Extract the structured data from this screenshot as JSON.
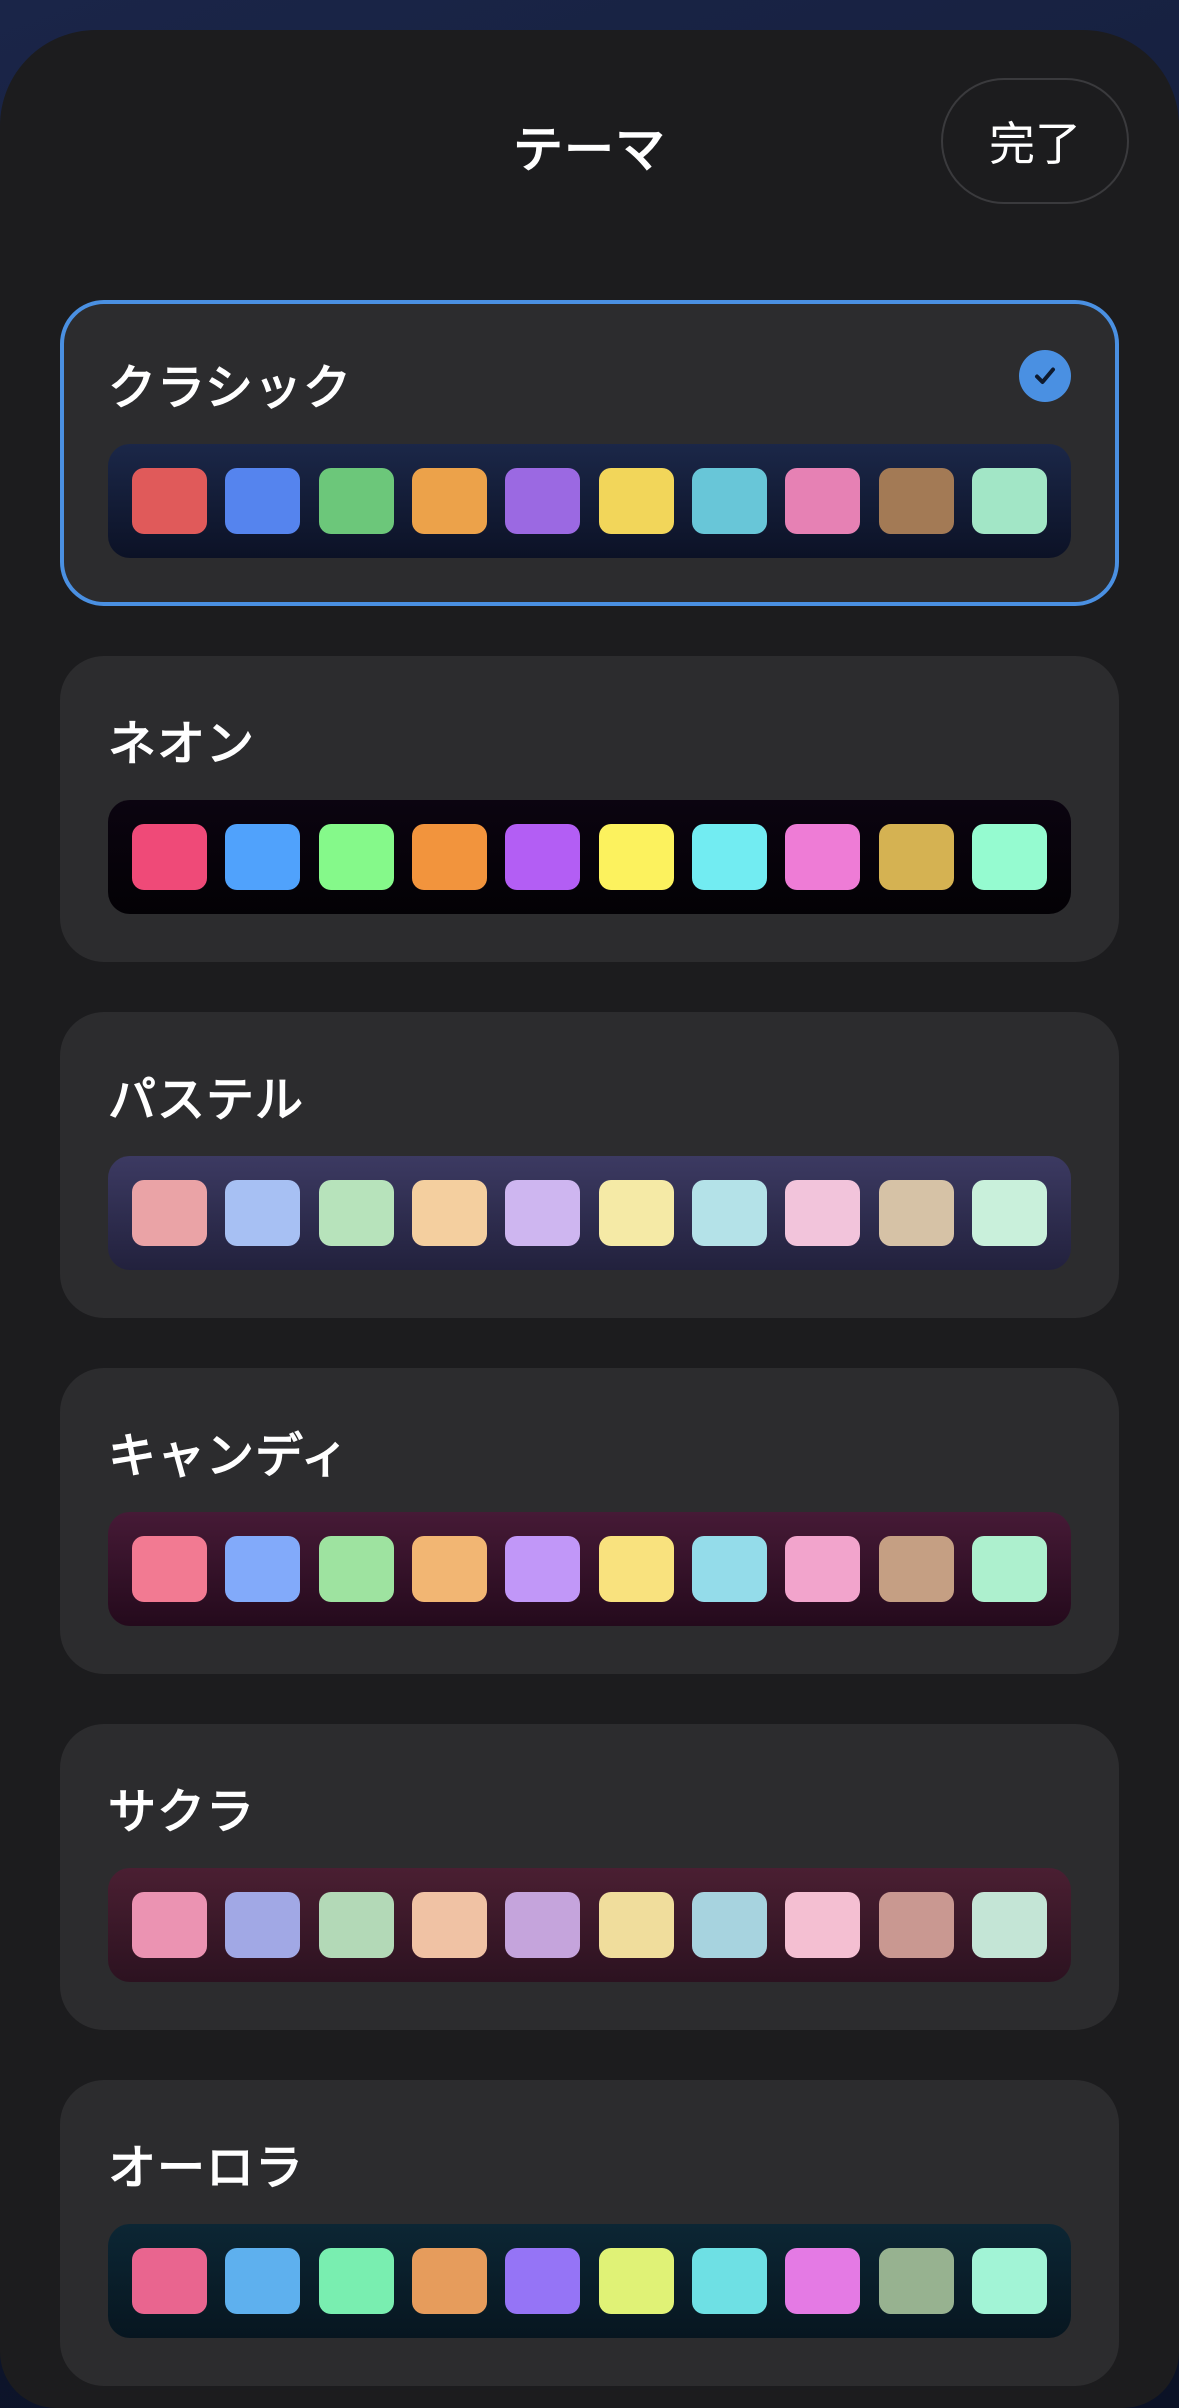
{
  "header": {
    "title": "テーマ",
    "done_label": "完了"
  },
  "accent_color": "#4a90e2",
  "selected_theme": "クラシック",
  "themes": [
    {
      "name": "クラシック",
      "selected": true,
      "strip_gradient": [
        "#1b2748",
        "#0c1226"
      ],
      "colors": [
        "#e05a5a",
        "#5584ee",
        "#6cc77a",
        "#eca24a",
        "#9b69e2",
        "#f2d65a",
        "#68c6d8",
        "#e681b4",
        "#a37a55",
        "#a2e6c6"
      ]
    },
    {
      "name": "ネオン",
      "selected": false,
      "strip_gradient": [
        "#0b0410",
        "#030105"
      ],
      "colors": [
        "#ef4a78",
        "#50a2fc",
        "#85f98a",
        "#f2943d",
        "#b35ef4",
        "#fcf25e",
        "#72ecf2",
        "#ee7cd6",
        "#d5b252",
        "#95fbd0"
      ]
    },
    {
      "name": "パステル",
      "selected": false,
      "strip_gradient": [
        "#3c3a62",
        "#22213d"
      ],
      "colors": [
        "#eaa3a6",
        "#a7c0f3",
        "#b7e3bb",
        "#f4cf9f",
        "#ceb6f0",
        "#f5eaa6",
        "#b4e2e8",
        "#f2c4db",
        "#d6c2a6",
        "#c9f0db"
      ]
    },
    {
      "name": "キャンディ",
      "selected": false,
      "strip_gradient": [
        "#461a36",
        "#240a1c"
      ],
      "colors": [
        "#f27a92",
        "#82aafa",
        "#9ee3a0",
        "#f2b673",
        "#c197f8",
        "#f9e27e",
        "#94dcea",
        "#f2a4cc",
        "#c59f83",
        "#adf0ce"
      ]
    },
    {
      "name": "サクラ",
      "selected": false,
      "strip_gradient": [
        "#4a1f32",
        "#2c1220"
      ],
      "colors": [
        "#eb93b2",
        "#a1a8e5",
        "#b3d9b7",
        "#f0c2a4",
        "#c5a4dc",
        "#f0dd9c",
        "#a7d3df",
        "#f4bfd2",
        "#c99891",
        "#c4e5d6"
      ]
    },
    {
      "name": "オーロラ",
      "selected": false,
      "strip_gradient": [
        "#0c2634",
        "#071620"
      ],
      "colors": [
        "#e9658f",
        "#5eb0ee",
        "#79eeb0",
        "#e69c5c",
        "#9574f6",
        "#e0f276",
        "#6ee0e4",
        "#e47ae4",
        "#97b290",
        "#a2f4d6"
      ]
    }
  ]
}
